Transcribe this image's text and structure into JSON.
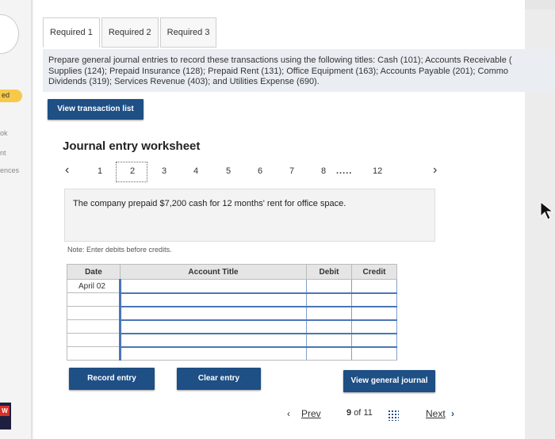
{
  "left_strip": {
    "badge": "ed",
    "labels": [
      "ok",
      "nt",
      "ences"
    ],
    "w_badge": "W"
  },
  "tabs": [
    {
      "label": "Required 1",
      "active": true
    },
    {
      "label": "Required 2",
      "active": false
    },
    {
      "label": "Required 3",
      "active": false
    }
  ],
  "instructions": {
    "line1": "Prepare general journal entries to record these transactions using the following titles: Cash (101); Accounts Receivable (",
    "line2": "Supplies (124); Prepaid Insurance (128); Prepaid Rent (131); Office Equipment (163); Accounts Payable (201); Commo",
    "line3": "Dividends (319); Services Revenue (403); and Utilities Expense (690)."
  },
  "view_transaction_label": "View transaction list",
  "worksheet_title": "Journal entry worksheet",
  "pager": {
    "prev_icon": "chevron-left-icon",
    "pages": [
      "1",
      "2",
      "3",
      "4",
      "5",
      "6",
      "7",
      "8"
    ],
    "ellipsis": ".....",
    "last_page": "12",
    "active_page": "2",
    "next_icon": "chevron-right-icon"
  },
  "transaction_text": "The company prepaid $7,200 cash for 12 months' rent for office space.",
  "note": "Note: Enter debits before credits.",
  "table": {
    "headers": {
      "date": "Date",
      "account": "Account Title",
      "debit": "Debit",
      "credit": "Credit"
    },
    "first_date": "April 02"
  },
  "buttons": {
    "record": "Record entry",
    "clear": "Clear entry",
    "view_general": "View general journal"
  },
  "footer": {
    "prev": "Prev",
    "page_current": "9",
    "page_of": "of",
    "page_total": "11",
    "next": "Next"
  },
  "colors": {
    "primary_button": "#1e4f85",
    "badge": "#f6c94a"
  }
}
